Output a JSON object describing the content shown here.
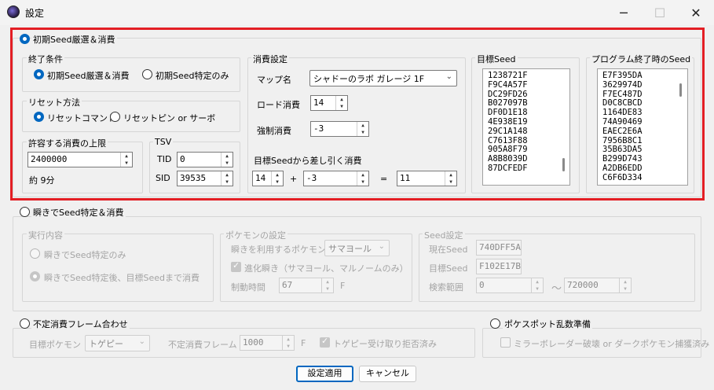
{
  "window": {
    "title": "設定"
  },
  "sec1": {
    "title": "初期Seed厳選＆消費",
    "end_cond": {
      "label": "終了条件",
      "opt1": "初期Seed厳選＆消費",
      "opt2": "初期Seed特定のみ"
    },
    "reset": {
      "label": "リセット方法",
      "opt1": "リセットコマンド",
      "opt2": "リセットピン or サーボ"
    },
    "limit": {
      "label": "許容する消費の上限",
      "value": "2400000",
      "approx": "約 9分"
    },
    "tsv": {
      "label": "TSV",
      "tid_label": "TID",
      "tid": "0",
      "sid_label": "SID",
      "sid": "39535"
    },
    "consume": {
      "label": "消費設定",
      "map_label": "マップ名",
      "map": "シャドーのラボ ガレージ 1F",
      "load_label": "ロード消費",
      "load": "14",
      "force_label": "強制消費",
      "force": "-3",
      "sub_label": "目標Seedから差し引く消費",
      "a": "14",
      "plus": "+",
      "b": "-3",
      "eq": "=",
      "result": "11"
    },
    "target_seed": {
      "label": "目標Seed",
      "items": [
        "1238721F",
        "F9C4A57F",
        "DC29FD26",
        "B027097B",
        "DF0D1E18",
        "4E938E19",
        "29C1A148",
        "C7613F88",
        "905A8F79",
        "A8B8039D",
        "87DCFEDF"
      ]
    },
    "end_seed": {
      "label": "プログラム終了時のSeed",
      "items": [
        "E7F395DA",
        "3629974D",
        "F7EC487D",
        "D0C8CBCD",
        "1164DE83",
        "74A90469",
        "EAEC2E6A",
        "7956B8C1",
        "35B63DA5",
        "B299D743",
        "A2DB6EDD",
        "C6F6D334"
      ]
    }
  },
  "sec2": {
    "title": "瞬きでSeed特定＆消費",
    "exec": {
      "label": "実行内容",
      "opt1": "瞬きでSeed特定のみ",
      "opt2": "瞬きでSeed特定後、目標Seedまで消費"
    },
    "poke": {
      "label": "ポケモンの設定",
      "blink_label": "瞬きを利用するポケモン",
      "blink_poke": "サマヨール",
      "evo_label": "進化瞬き（サマヨール、マルノームのみ）",
      "ctrl_label": "制動時間",
      "ctrl": "67",
      "unit": "F"
    },
    "seed": {
      "label": "Seed設定",
      "cur_label": "現在Seed",
      "cur": "740DFF5A",
      "tgt_label": "目標Seed",
      "tgt": "F102E17B",
      "range_label": "検索範囲",
      "from": "0",
      "tilde": "〜",
      "to": "720000"
    }
  },
  "sec3": {
    "title": "不定消費フレーム合わせ",
    "poke_label": "目標ポケモン",
    "poke": "トゲピー",
    "frame_label": "不定消費フレーム",
    "frame": "1000",
    "unit": "F",
    "chk_label": "トゲピー受け取り拒否済み"
  },
  "sec4": {
    "title": "ポケスポット乱数準備",
    "chk_label": "ミラーボレーダー破壊 or ダークポケモン捕獲済み"
  },
  "buttons": {
    "apply": "設定適用",
    "cancel": "キャンセル"
  }
}
